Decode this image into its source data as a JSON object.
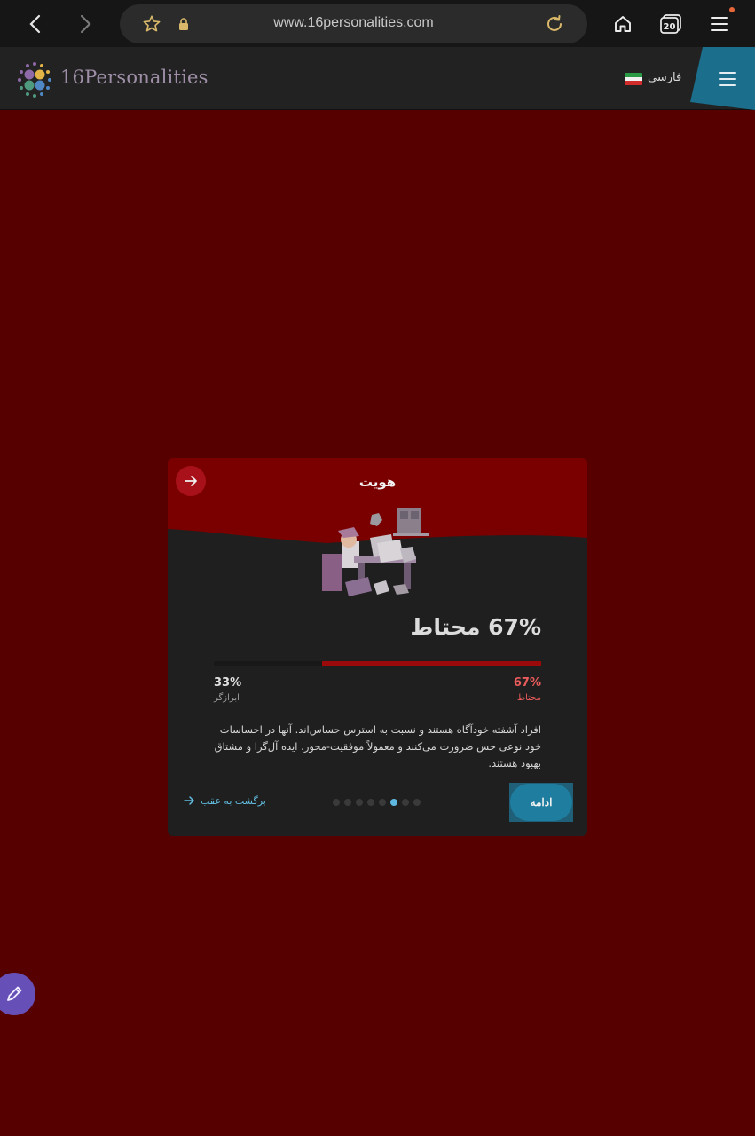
{
  "browser": {
    "url": "www.16personalities.com",
    "tab_count": "20"
  },
  "header": {
    "logo_text": "16Personalities",
    "language": "فارسی"
  },
  "card": {
    "title": "هویت",
    "result_text": "67% محتاط",
    "right_percent": "67%",
    "right_label": "محتاط",
    "left_percent": "33%",
    "left_label": "ابرازگر",
    "progress_fraction": 0.67,
    "description": "افراد آشفته خودآگاه هستند و نسبت به استرس حساس‌اند. آنها در احساسات خود نوعی حس ضرورت می‌کنند و معمولاً موفقیت-محور، ایده آل‌گرا و مشتاق بهبود هستند.",
    "continue_label": "ادامه",
    "back_label": "برگشت به عقب",
    "pages_total": 8,
    "pages_active_index": 5
  },
  "colors": {
    "page_bg": "#560000",
    "card_top": "#7a0000",
    "accent_blue": "#1f7ea0",
    "accent_red": "#ea5b5b"
  },
  "icons": [
    "back-icon",
    "forward-icon",
    "star-icon",
    "lock-icon",
    "reload-icon",
    "home-icon",
    "tabs-icon",
    "menu-icon",
    "hamburger-icon",
    "arrow-right-icon",
    "pencil-icon"
  ]
}
